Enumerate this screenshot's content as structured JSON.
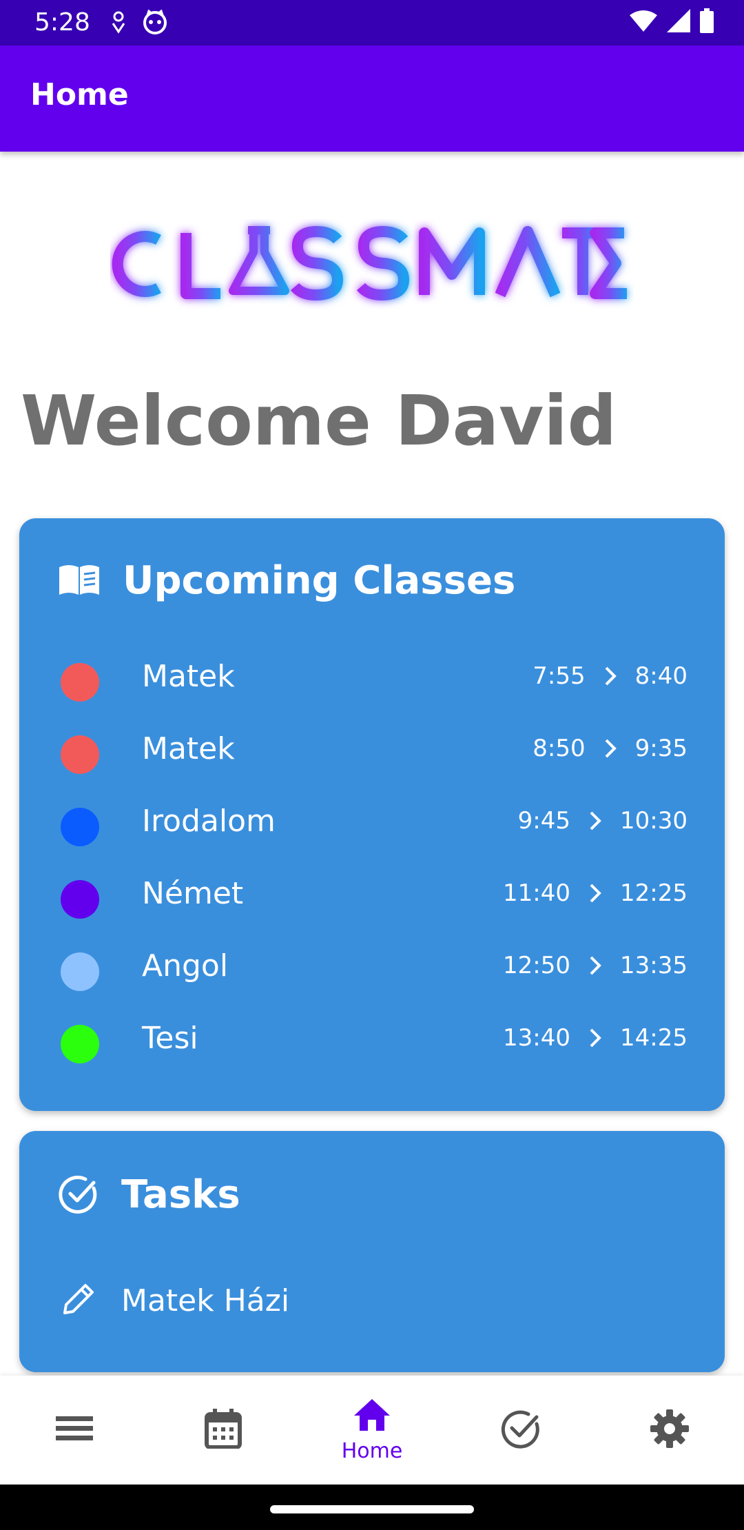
{
  "status_bar": {
    "time": "5:28"
  },
  "app_bar": {
    "title": "Home"
  },
  "logo": {
    "text": "CLASSMATE"
  },
  "welcome": "Welcome David",
  "upcoming": {
    "title": "Upcoming Classes",
    "classes": [
      {
        "name": "Matek",
        "start": "7:55",
        "end": "8:40",
        "color": "#f25a5a"
      },
      {
        "name": "Matek",
        "start": "8:50",
        "end": "9:35",
        "color": "#f25a5a"
      },
      {
        "name": "Irodalom",
        "start": "9:45",
        "end": "10:30",
        "color": "#0a5cff"
      },
      {
        "name": "Német",
        "start": "11:40",
        "end": "12:25",
        "color": "#6200ee"
      },
      {
        "name": "Angol",
        "start": "12:50",
        "end": "13:35",
        "color": "#8ec2ff"
      },
      {
        "name": "Tesi",
        "start": "13:40",
        "end": "14:25",
        "color": "#2bff0e"
      }
    ]
  },
  "tasks": {
    "title": "Tasks",
    "items": [
      {
        "label": "Matek Házi"
      }
    ]
  },
  "bottom_nav": {
    "active_label": "Home",
    "items": [
      "list-icon",
      "calendar-icon",
      "home-icon",
      "check-circle-icon",
      "settings-icon"
    ]
  },
  "colors": {
    "primary": "#6200ee",
    "primary_dark": "#3700b3",
    "card": "#3a8fdd",
    "text_gray": "#707070"
  }
}
